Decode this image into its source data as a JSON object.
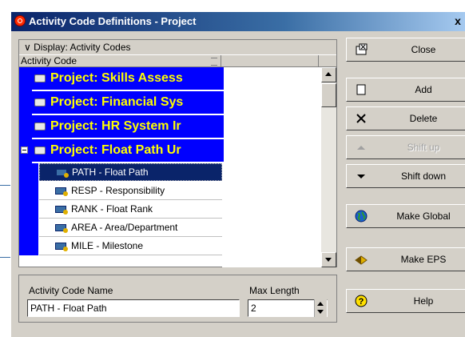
{
  "window": {
    "title": "Activity Code Definitions - Project",
    "close_glyph": "x"
  },
  "display_label": "Display: Activity Codes",
  "columns": {
    "activity_code": "Activity Code"
  },
  "projects": [
    {
      "label": "Project: Skills Assess"
    },
    {
      "label": "Project: Financial Sys"
    },
    {
      "label": "Project: HR System Ir"
    },
    {
      "label": "Project: Float Path Ur"
    }
  ],
  "codes": [
    {
      "label": "PATH - Float Path",
      "selected": true
    },
    {
      "label": "RESP - Responsibility",
      "selected": false
    },
    {
      "label": "RANK - Float Rank",
      "selected": false
    },
    {
      "label": "AREA - Area/Department",
      "selected": false
    },
    {
      "label": "MILE - Milestone",
      "selected": false
    }
  ],
  "form": {
    "name_label": "Activity Code Name",
    "name_value": "PATH - Float Path",
    "maxlen_label": "Max Length",
    "maxlen_value": "2"
  },
  "buttons": {
    "close": "Close",
    "add": "Add",
    "delete": "Delete",
    "shift_up": "Shift up",
    "shift_down": "Shift down",
    "make_global": "Make Global",
    "make_eps": "Make EPS",
    "help": "Help"
  },
  "colors": {
    "highlight_blue": "#0000ff",
    "project_text": "#ffff00",
    "selection": "#0a246a"
  }
}
